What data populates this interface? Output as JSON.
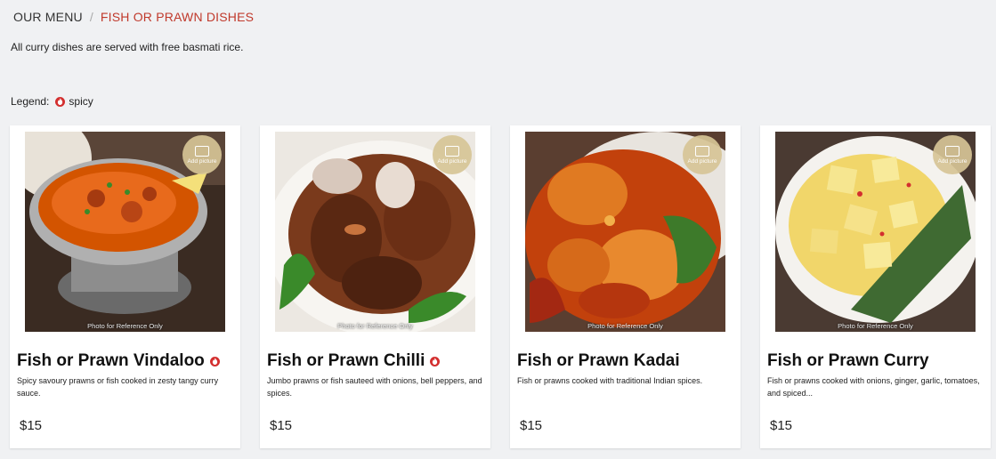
{
  "breadcrumb": {
    "root": "OUR MENU",
    "separator": "/",
    "current": "FISH OR PRAWN DISHES"
  },
  "intro_text": "All curry dishes are served with free basmati rice.",
  "legend": {
    "label": "Legend:",
    "spicy_text": "spicy",
    "spicy_icon": "flame-icon",
    "spicy_color": "#d32f2f"
  },
  "common": {
    "photo_caption": "Photo for Reference Only",
    "add_picture": "Add picture"
  },
  "dishes": [
    {
      "name": "Fish or Prawn Vindaloo",
      "spicy": true,
      "description": "Spicy savoury prawns or fish cooked in zesty tangy curry sauce.",
      "price": "$15"
    },
    {
      "name": "Fish or Prawn Chilli",
      "spicy": true,
      "description": "Jumbo prawns or fish sauteed with onions, bell peppers, and spices.",
      "price": "$15"
    },
    {
      "name": "Fish or Prawn Kadai",
      "spicy": false,
      "description": "Fish or prawns cooked with traditional Indian spices.",
      "price": "$15"
    },
    {
      "name": "Fish or Prawn Curry",
      "spicy": false,
      "description": "Fish or prawns cooked with onions, ginger, garlic, tomatoes, and spiced...",
      "price": "$15"
    }
  ]
}
